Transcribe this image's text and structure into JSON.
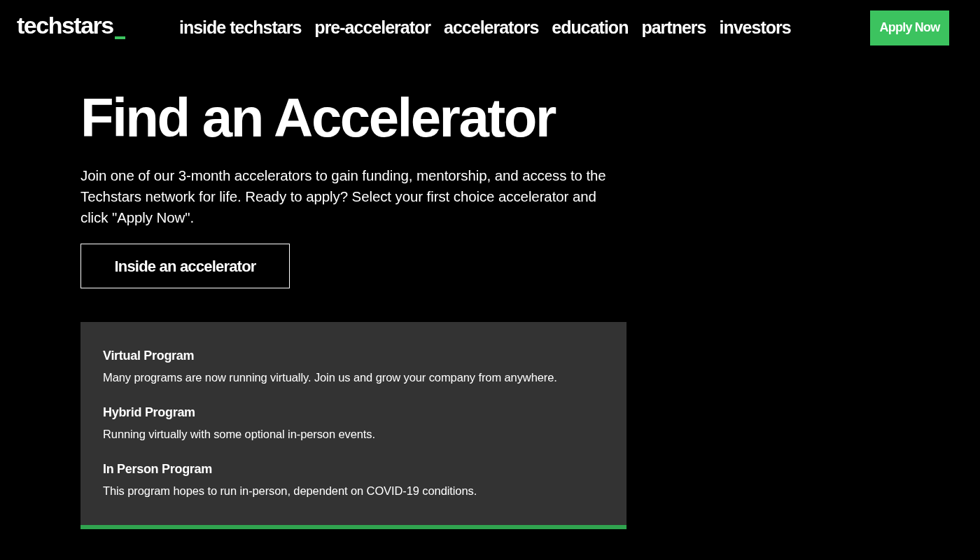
{
  "header": {
    "logo": "techstars",
    "nav": [
      "inside techstars",
      "pre-accelerator",
      "accelerators",
      "education",
      "partners",
      "investors"
    ],
    "apply_button": "Apply Now"
  },
  "hero": {
    "title": "Find an Accelerator",
    "intro": "Join one of our 3-month accelerators to gain funding, mentorship, and access to the Techstars network for life. Ready to apply? Select your first choice accelerator and click \"Apply Now\".",
    "button": "Inside an accelerator"
  },
  "programs": [
    {
      "title": "Virtual Program",
      "description": "Many programs are now running virtually. Join us and grow your company from anywhere."
    },
    {
      "title": "Hybrid Program",
      "description": "Running virtually with some optional in-person events."
    },
    {
      "title": "In Person Program",
      "description": "This program hopes to run in-person, dependent on COVID-19 conditions."
    }
  ]
}
